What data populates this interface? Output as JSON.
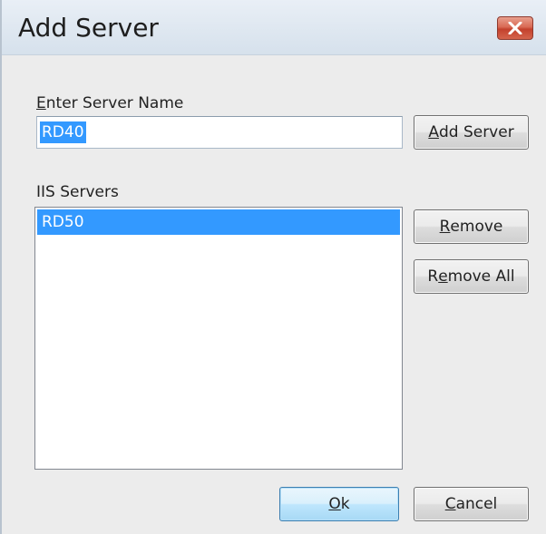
{
  "window": {
    "title": "Add Server",
    "close_icon": "close-icon",
    "accent_color": "#3399ff"
  },
  "server_name": {
    "label_accel": "E",
    "label_rest": "nter Server Name",
    "value": "RD40"
  },
  "buttons": {
    "add_server_accel": "A",
    "add_server_rest": "dd Server",
    "remove_accel": "R",
    "remove_rest": "emove",
    "remove_all_pre": "R",
    "remove_all_accel": "e",
    "remove_all_rest": "move All",
    "ok_accel": "O",
    "ok_rest": "k",
    "cancel_accel": "C",
    "cancel_rest": "ancel"
  },
  "iis_servers": {
    "label": "IIS Servers",
    "items": [
      "RD50"
    ],
    "selected_index": 0
  }
}
